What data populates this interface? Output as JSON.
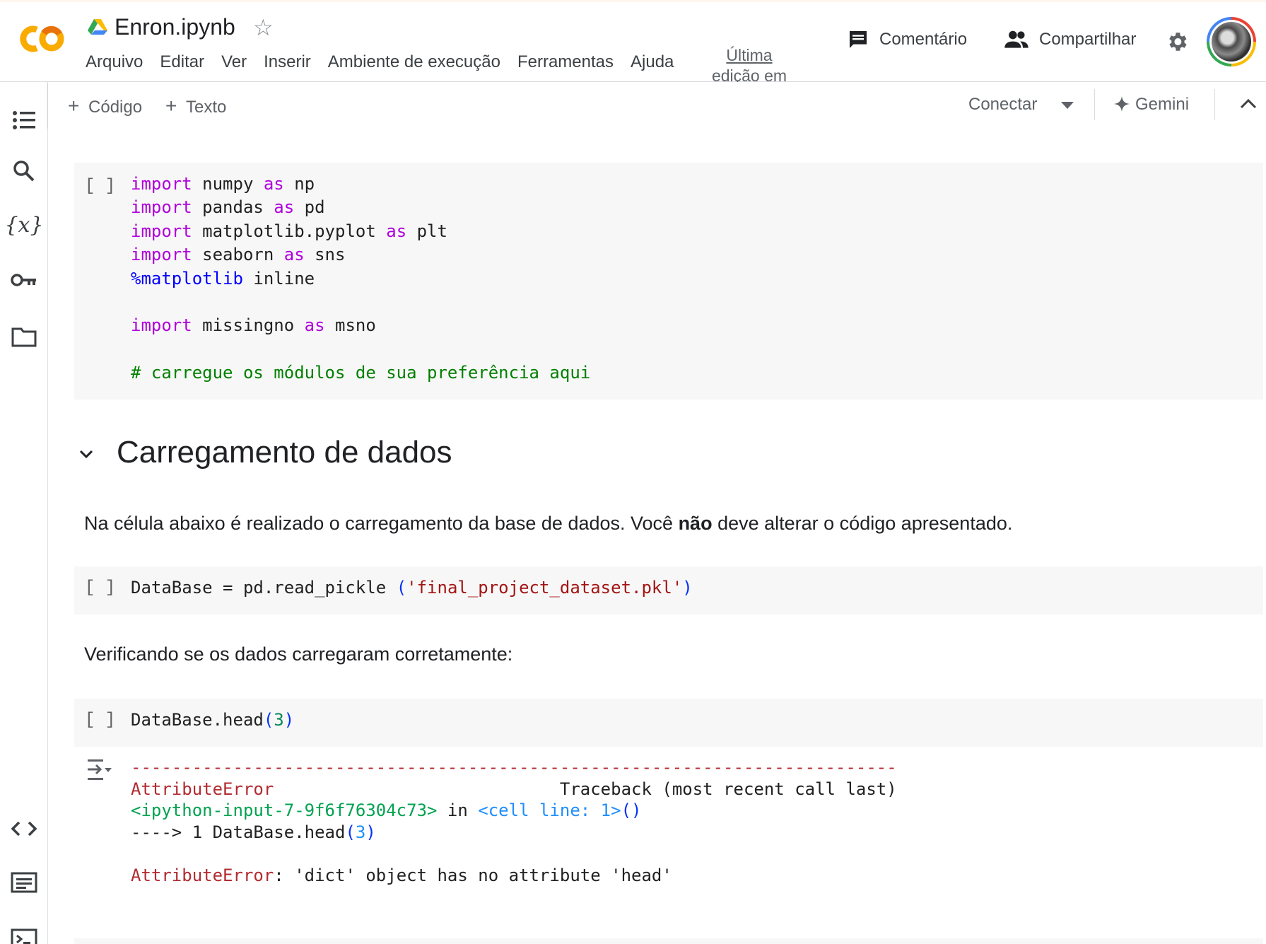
{
  "header": {
    "notebook_title": "Enron.ipynb",
    "menu": [
      "Arquivo",
      "Editar",
      "Ver",
      "Inserir",
      "Ambiente de execução",
      "Ferramentas",
      "Ajuda"
    ],
    "last_edit_line1": "Última",
    "last_edit_line2": "edição em",
    "comment_label": "Comentário",
    "share_label": "Compartilhar",
    "logo_text": "CO"
  },
  "toolbar": {
    "add_code": "Código",
    "add_text": "Texto",
    "connect": "Conectar",
    "gemini": "Gemini"
  },
  "rail": {
    "icons": [
      "table-of-contents-icon",
      "search-icon",
      "variables-icon",
      "secrets-key-icon",
      "files-folder-icon",
      "code-snippets-icon",
      "command-palette-icon",
      "terminal-icon"
    ]
  },
  "cells": {
    "run_bracket": "[ ]",
    "imports": {
      "l1_kw": "import",
      "l1_mod": " numpy ",
      "l1_as": "as",
      "l1_alias": " np",
      "l2_kw": "import",
      "l2_mod": " pandas ",
      "l2_as": "as",
      "l2_alias": " pd",
      "l3_kw": "import",
      "l3_mod": " matplotlib.pyplot ",
      "l3_as": "as",
      "l3_alias": " plt",
      "l4_kw": "import",
      "l4_mod": " seaborn ",
      "l4_as": "as",
      "l4_alias": " sns",
      "l5_magic": "%matplotlib",
      "l5_rest": " inline",
      "l7_kw": "import",
      "l7_mod": " missingno ",
      "l7_as": "as",
      "l7_alias": " msno",
      "l9_comment": "# carregue os módulos de sua preferência aqui"
    },
    "section_heading": "Carregamento de dados",
    "md_load_before": "Na célula abaixo é realizado o carregamento da base de dados. Você ",
    "md_load_bold": "não",
    "md_load_after": " deve alterar o código apresentado.",
    "load_code_a": "DataBase = pd.read_pickle ",
    "load_code_paren_open": "(",
    "load_code_str": "'final_project_dataset.pkl'",
    "load_code_paren_close": ")",
    "md_check": "Verificando se os dados carregaram corretamente:",
    "head_code_a": "DataBase.head",
    "head_code_paren_open": "(",
    "head_code_num": "3",
    "head_code_paren_close": ")"
  },
  "output": {
    "dashes": "---------------------------------------------------------------------------",
    "err_name": "AttributeError",
    "traceback": "Traceback (most recent call last)",
    "input_ref": "<ipython-input-7-9f6f76304c73>",
    "in_word": " in ",
    "cell_line": "<cell line: 1>",
    "cell_parens": "()",
    "arrow_line": "----> 1 DataBase.head",
    "arrow_paren_open": "(",
    "arrow_num": "3",
    "arrow_paren_close": ")",
    "final_err_name": "AttributeError",
    "final_err_msg": ": 'dict' object has no attribute 'head'"
  },
  "colors": {
    "accent_orange": "#f9ab00",
    "keyword": "#af00db",
    "comment": "#008000",
    "string": "#a31515",
    "error": "#b22b31"
  }
}
